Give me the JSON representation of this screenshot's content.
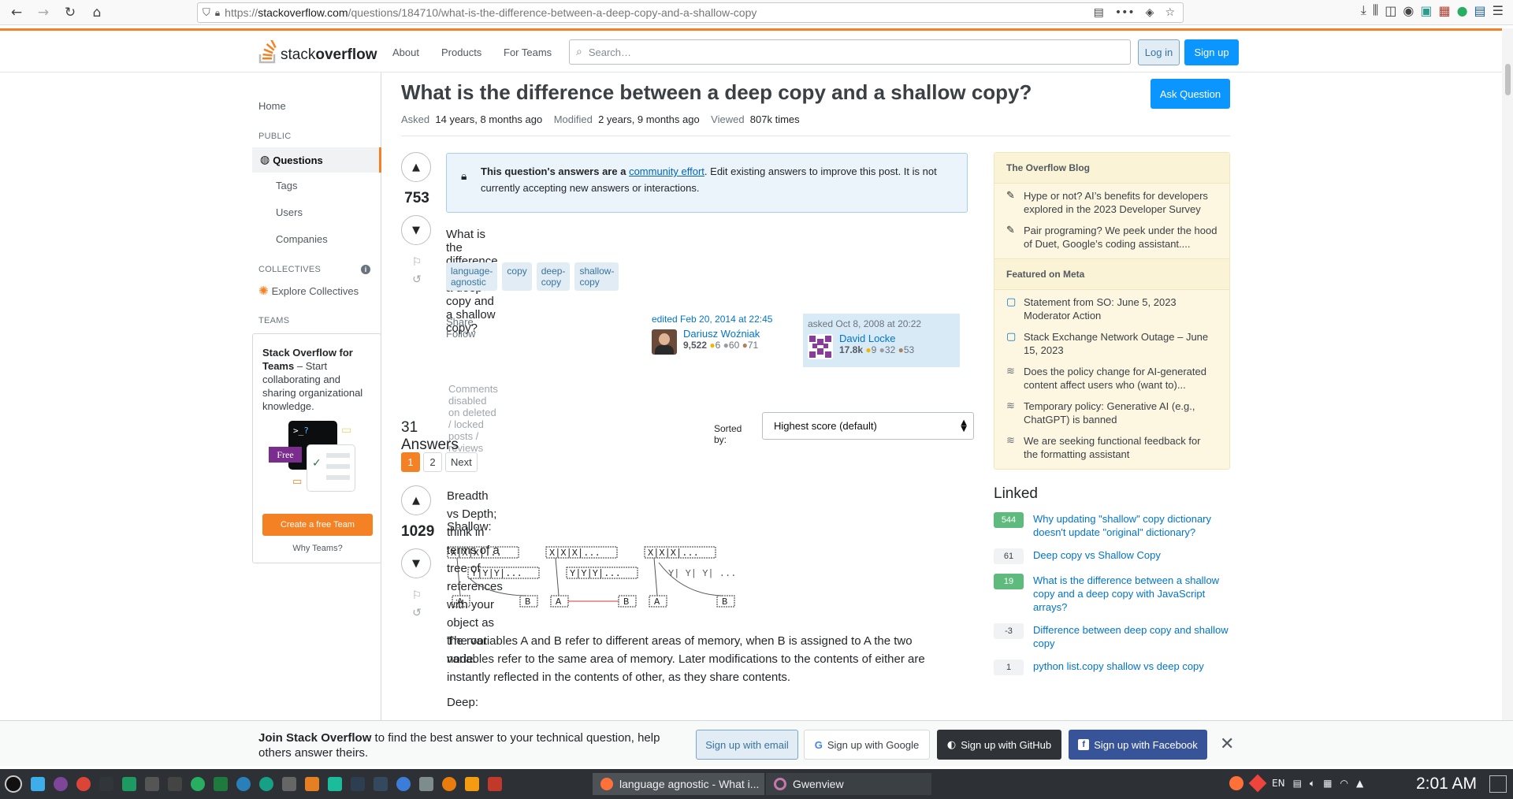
{
  "browser": {
    "url_prefix": "https://",
    "url_domain": "stackoverflow.com",
    "url_path": "/questions/184710/what-is-the-difference-between-a-deep-copy-and-a-shallow-copy"
  },
  "header": {
    "logo_light": "stack",
    "logo_bold": "overflow",
    "nav": [
      "About",
      "Products",
      "For Teams"
    ],
    "search_placeholder": "Search…",
    "login": "Log in",
    "signup": "Sign up"
  },
  "leftnav": {
    "home": "Home",
    "public_head": "PUBLIC",
    "questions": "Questions",
    "tags": "Tags",
    "users": "Users",
    "companies": "Companies",
    "collectives_head": "COLLECTIVES",
    "explore": "Explore Collectives",
    "teams_head": "TEAMS",
    "teams_title": "Stack Overflow for Teams",
    "teams_rest": " – Start collaborating and sharing organizational knowledge.",
    "free_badge": "Free",
    "create_team": "Create a free Team",
    "why_teams": "Why Teams?"
  },
  "question": {
    "title": "What is the difference between a deep copy and a shallow copy?",
    "ask_button": "Ask Question",
    "asked_label": "Asked",
    "asked_value": "14 years, 8 months ago",
    "modified_label": "Modified",
    "modified_value": "2 years, 9 months ago",
    "viewed_label": "Viewed",
    "viewed_value": "807k times",
    "votes": "753",
    "notice_bold": "This question's answers are a ",
    "notice_link": "community effort",
    "notice_rest": ". Edit existing answers to improve this post. It is not currently accepting new answers or interactions.",
    "body": "What is the difference between a deep copy and a shallow copy?",
    "tags": [
      "language-agnostic",
      "copy",
      "deep-copy",
      "shallow-copy"
    ],
    "share": "Share",
    "follow": "Follow",
    "edited": "edited Feb 20, 2014 at 22:45",
    "editor_name": "Dariusz Woźniak",
    "editor_rep": "9,522",
    "editor_gold": "6",
    "editor_silver": "60",
    "editor_bronze": "71",
    "asked_on": "asked Oct 8, 2008 at 20:22",
    "asker_name": "David Locke",
    "asker_rep": "17.8k",
    "asker_gold": "9",
    "asker_silver": "32",
    "asker_bronze": "53",
    "comments_disabled": "Comments disabled on deleted / locked posts / reviews"
  },
  "answers": {
    "count_label": "31 Answers",
    "sort_label": "Sorted by:",
    "sort_value": "Highest score (default)",
    "pages": [
      "1",
      "2",
      "Next"
    ],
    "first_votes": "1029",
    "p1": "Breadth vs Depth; think in terms of a tree of references with your object as the root node.",
    "shallow": "Shallow:",
    "p2": "The variables A and B refer to different areas of memory, when B is assigned to A the two variables refer to the same area of memory. Later modifications to the contents of either are instantly reflected in the contents of other, as they share contents.",
    "deep": "Deep:"
  },
  "sidebar": {
    "blog_head": "The Overflow Blog",
    "blog_items": [
      "Hype or not? AI’s benefits for developers explored in the 2023 Developer Survey",
      "Pair programing? We peek under the hood of Duet, Google’s coding assistant...."
    ],
    "meta_head": "Featured on Meta",
    "meta_items": [
      "Statement from SO: June 5, 2023 Moderator Action",
      "Stack Exchange Network Outage – June 15, 2023",
      "Does the policy change for AI-generated content affect users who (want to)...",
      "Temporary policy: Generative AI (e.g., ChatGPT) is banned",
      "We are seeking functional feedback for the formatting assistant"
    ],
    "linked_head": "Linked",
    "linked": [
      {
        "count": "544",
        "text": "Why updating \"shallow\" copy dictionary doesn't update \"original\" dictionary?"
      },
      {
        "count": "61",
        "text": "Deep copy vs Shallow Copy"
      },
      {
        "count": "19",
        "text": "What is the difference between a shallow copy and a deep copy with JavaScript arrays?"
      },
      {
        "count": "-3",
        "text": "Difference between deep copy and shallow copy"
      },
      {
        "count": "1",
        "text": "python list.copy shallow vs deep copy"
      }
    ]
  },
  "banner": {
    "bold": "Join Stack Overflow",
    "rest": " to find the best answer to your technical question, help others answer theirs.",
    "email": "Sign up with email",
    "google": "Sign up with Google",
    "github": "Sign up with GitHub",
    "facebook": "Sign up with Facebook"
  },
  "taskbar": {
    "task1": "language agnostic - What i...",
    "task2": "Gwenview",
    "lang": "EN",
    "clock": "2:01 AM"
  }
}
